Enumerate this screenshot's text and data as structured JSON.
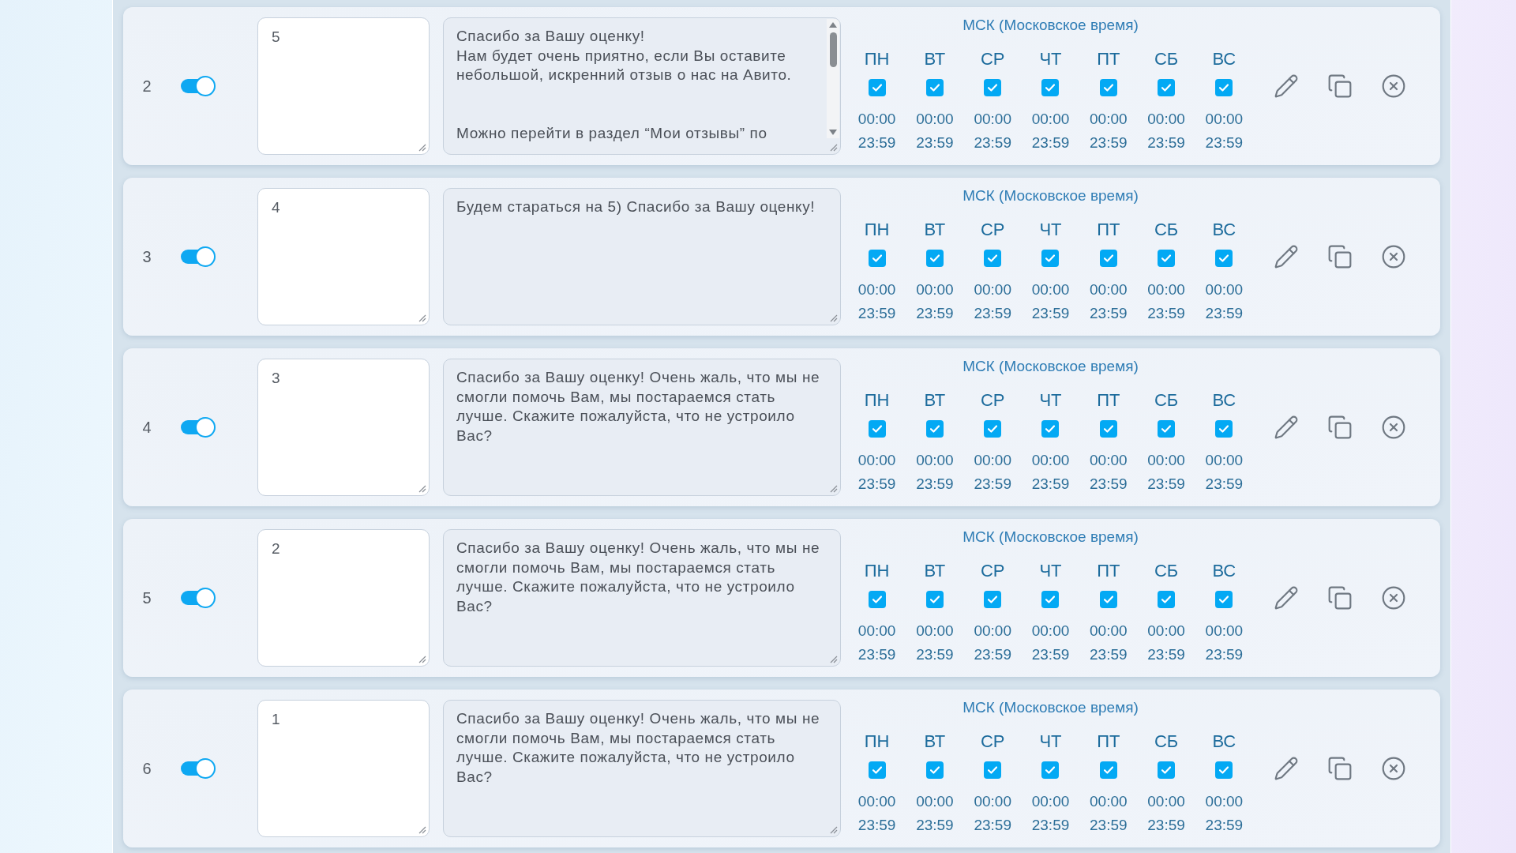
{
  "rules": [
    {
      "number": "2",
      "enabled": true,
      "rating": "5",
      "reply": "Спасибо за Вашу оценку!\nНам будет очень приятно, если Вы оставите небольшой, искренний отзыв о нас на Авито.\n\n\nМожно перейти в раздел “Мои отзывы” по",
      "timezone": "МСК (Московское время)",
      "days": [
        {
          "label": "ПН",
          "checked": true,
          "start": "00:00",
          "end": "23:59"
        },
        {
          "label": "ВТ",
          "checked": true,
          "start": "00:00",
          "end": "23:59"
        },
        {
          "label": "СР",
          "checked": true,
          "start": "00:00",
          "end": "23:59"
        },
        {
          "label": "ЧТ",
          "checked": true,
          "start": "00:00",
          "end": "23:59"
        },
        {
          "label": "ПТ",
          "checked": true,
          "start": "00:00",
          "end": "23:59"
        },
        {
          "label": "СБ",
          "checked": true,
          "start": "00:00",
          "end": "23:59"
        },
        {
          "label": "ВС",
          "checked": true,
          "start": "00:00",
          "end": "23:59"
        }
      ]
    },
    {
      "number": "3",
      "enabled": true,
      "rating": "4",
      "reply": "Будем стараться на 5) Спасибо за Вашу оценку!",
      "timezone": "МСК (Московское время)",
      "days": [
        {
          "label": "ПН",
          "checked": true,
          "start": "00:00",
          "end": "23:59"
        },
        {
          "label": "ВТ",
          "checked": true,
          "start": "00:00",
          "end": "23:59"
        },
        {
          "label": "СР",
          "checked": true,
          "start": "00:00",
          "end": "23:59"
        },
        {
          "label": "ЧТ",
          "checked": true,
          "start": "00:00",
          "end": "23:59"
        },
        {
          "label": "ПТ",
          "checked": true,
          "start": "00:00",
          "end": "23:59"
        },
        {
          "label": "СБ",
          "checked": true,
          "start": "00:00",
          "end": "23:59"
        },
        {
          "label": "ВС",
          "checked": true,
          "start": "00:00",
          "end": "23:59"
        }
      ]
    },
    {
      "number": "4",
      "enabled": true,
      "rating": "3",
      "reply": "Спасибо за Вашу оценку! Очень жаль, что мы не смогли помочь Вам, мы постараемся стать лучше. Скажите пожалуйста, что не устроило Вас?",
      "timezone": "МСК (Московское время)",
      "days": [
        {
          "label": "ПН",
          "checked": true,
          "start": "00:00",
          "end": "23:59"
        },
        {
          "label": "ВТ",
          "checked": true,
          "start": "00:00",
          "end": "23:59"
        },
        {
          "label": "СР",
          "checked": true,
          "start": "00:00",
          "end": "23:59"
        },
        {
          "label": "ЧТ",
          "checked": true,
          "start": "00:00",
          "end": "23:59"
        },
        {
          "label": "ПТ",
          "checked": true,
          "start": "00:00",
          "end": "23:59"
        },
        {
          "label": "СБ",
          "checked": true,
          "start": "00:00",
          "end": "23:59"
        },
        {
          "label": "ВС",
          "checked": true,
          "start": "00:00",
          "end": "23:59"
        }
      ]
    },
    {
      "number": "5",
      "enabled": true,
      "rating": "2",
      "reply": "Спасибо за Вашу оценку! Очень жаль, что мы не смогли помочь Вам, мы постараемся стать лучше. Скажите пожалуйста, что не устроило Вас?",
      "timezone": "МСК (Московское время)",
      "days": [
        {
          "label": "ПН",
          "checked": true,
          "start": "00:00",
          "end": "23:59"
        },
        {
          "label": "ВТ",
          "checked": true,
          "start": "00:00",
          "end": "23:59"
        },
        {
          "label": "СР",
          "checked": true,
          "start": "00:00",
          "end": "23:59"
        },
        {
          "label": "ЧТ",
          "checked": true,
          "start": "00:00",
          "end": "23:59"
        },
        {
          "label": "ПТ",
          "checked": true,
          "start": "00:00",
          "end": "23:59"
        },
        {
          "label": "СБ",
          "checked": true,
          "start": "00:00",
          "end": "23:59"
        },
        {
          "label": "ВС",
          "checked": true,
          "start": "00:00",
          "end": "23:59"
        }
      ]
    },
    {
      "number": "6",
      "enabled": true,
      "rating": "1",
      "reply": "Спасибо за Вашу оценку! Очень жаль, что мы не смогли помочь Вам, мы постараемся стать лучше. Скажите пожалуйста, что не устроило Вас?",
      "timezone": "МСК (Московское время)",
      "days": [
        {
          "label": "ПН",
          "checked": true,
          "start": "00:00",
          "end": "23:59"
        },
        {
          "label": "ВТ",
          "checked": true,
          "start": "00:00",
          "end": "23:59"
        },
        {
          "label": "СР",
          "checked": true,
          "start": "00:00",
          "end": "23:59"
        },
        {
          "label": "ЧТ",
          "checked": true,
          "start": "00:00",
          "end": "23:59"
        },
        {
          "label": "ПТ",
          "checked": true,
          "start": "00:00",
          "end": "23:59"
        },
        {
          "label": "СБ",
          "checked": true,
          "start": "00:00",
          "end": "23:59"
        },
        {
          "label": "ВС",
          "checked": true,
          "start": "00:00",
          "end": "23:59"
        }
      ]
    }
  ]
}
